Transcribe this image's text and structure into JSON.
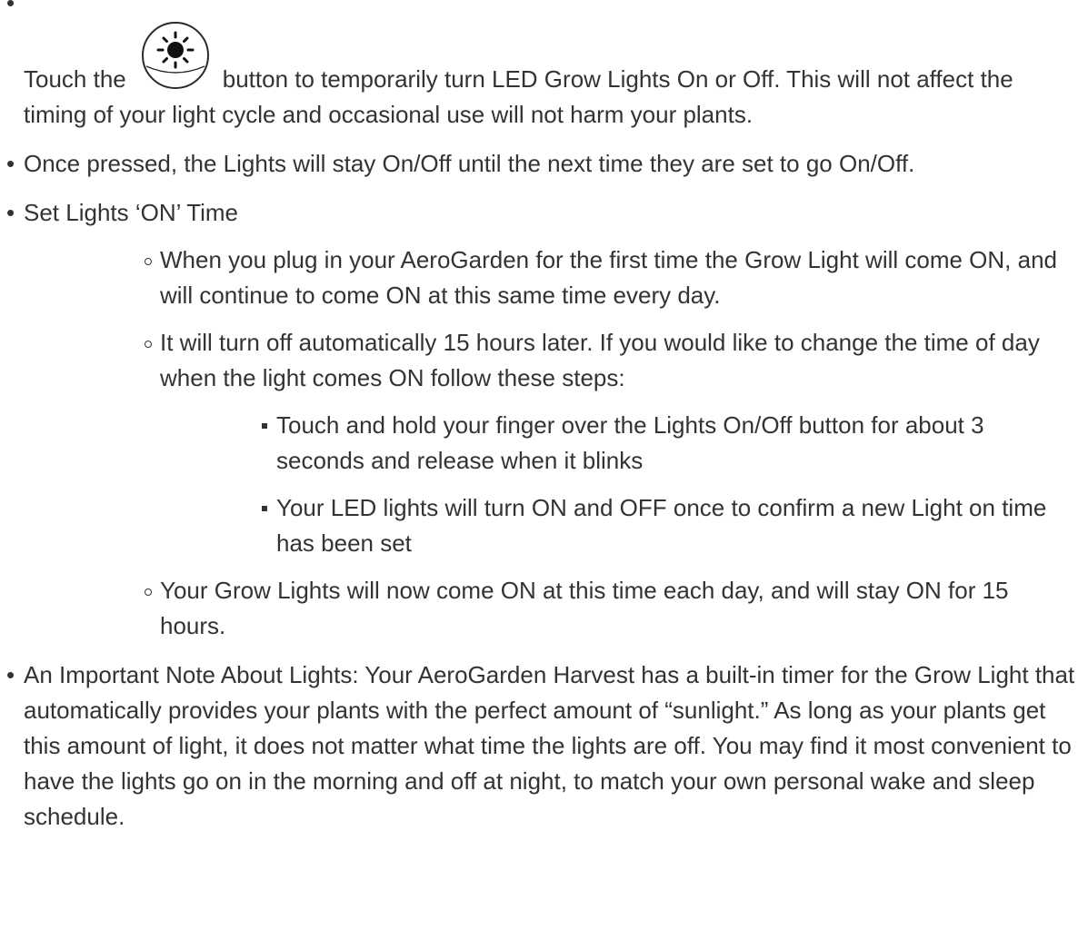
{
  "items": {
    "touch_before": "Touch the",
    "touch_after": "button to temporarily turn LED Grow Lights On or Off. This will not affect the timing of your light cycle and occasional use will not harm your plants.",
    "once_pressed": "Once pressed, the Lights will stay On/Off until the next time they are set to go On/Off.",
    "set_lights": "Set Lights ‘ON’ Time",
    "set_lights_sub": [
      "When you plug in your AeroGarden for the first time the Grow Light will come ON, and will continue to come ON at this same time every day.",
      "It will turn off automatically 15 hours later. If you would like to change the time of day when the light comes ON follow these steps:",
      "Your Grow Lights will now come ON at this time each day, and will stay ON for 15 hours."
    ],
    "steps": [
      "Touch and hold your finger over the Lights On/Off button for about 3 seconds and release when it blinks",
      "Your LED lights will turn ON and OFF once to confirm a new Light on time has been set"
    ],
    "important_note": "An Important Note About Lights: Your AeroGarden Harvest has a built-in timer for the Grow Light that automatically provides your plants with the perfect amount of “sunlight.” As long as your plants get this amount of light, it does not matter what time the lights are off. You may find it most convenient to have the lights go on in the morning and off at night, to match your own personal wake and sleep schedule."
  },
  "icons": {
    "light_button": "sun-icon"
  },
  "colors": {
    "text": "#333333",
    "background": "#ffffff"
  }
}
